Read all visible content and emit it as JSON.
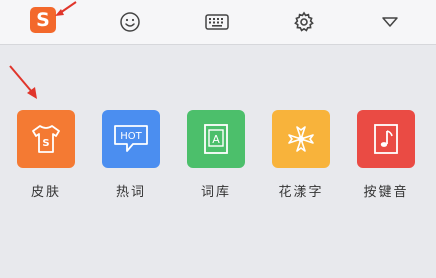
{
  "toolbar": {
    "logo_letter": "S",
    "icons": [
      "smiley-icon",
      "keyboard-icon",
      "gear-icon",
      "dropdown-triangle-icon"
    ]
  },
  "panel": {
    "items": [
      {
        "label": "皮肤",
        "icon": "shirt-icon",
        "icon_text": "S",
        "color": "#f47a33"
      },
      {
        "label": "热词",
        "icon": "hot-bubble-icon",
        "icon_text": "HOT",
        "color": "#4b8ef0"
      },
      {
        "label": "词库",
        "icon": "dictionary-icon",
        "icon_text": "A",
        "color": "#4cbf6b"
      },
      {
        "label": "花漾字",
        "icon": "flower-icon",
        "color": "#f8b33b"
      },
      {
        "label": "按键音",
        "icon": "music-note-icon",
        "color": "#ea4b44"
      }
    ]
  },
  "colors": {
    "accent": "#f3682b",
    "annotation_arrow": "#e0352b"
  }
}
